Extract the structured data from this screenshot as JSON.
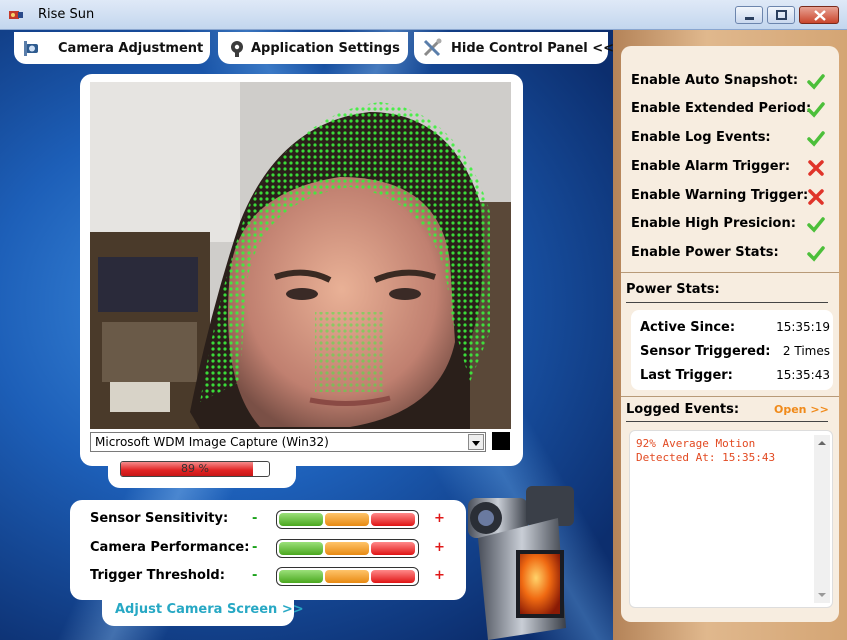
{
  "window": {
    "title": "Rise Sun",
    "icon": "camera-app-icon",
    "buttons": [
      "minimize",
      "maximize",
      "close"
    ]
  },
  "tabs": [
    {
      "label": "Camera Adjustment",
      "icon": "camera-adjust-icon"
    },
    {
      "label": "Application Settings",
      "icon": "settings-icon"
    },
    {
      "label": "Hide Control Panel <<",
      "icon": "tools-icon"
    }
  ],
  "capture": {
    "device": "Microsoft WDM Image Capture (Win32)",
    "motion_level": 89,
    "motion_text": "89 %"
  },
  "controls": [
    {
      "label": "Sensor Sensitivity:",
      "minus": "-",
      "plus": "+"
    },
    {
      "label": "Camera Performance:",
      "minus": "-",
      "plus": "+"
    },
    {
      "label": "Trigger Threshold:",
      "minus": "-",
      "plus": "+"
    }
  ],
  "adjust_link": "Adjust Camera Screen >>",
  "options": [
    {
      "label": "Enable Auto Snapshot:",
      "state": "enabled",
      "icon": "check-icon"
    },
    {
      "label": "Enable Extended Period:",
      "state": "enabled",
      "icon": "check-icon"
    },
    {
      "label": "Enable Log Events:",
      "state": "enabled",
      "icon": "check-icon"
    },
    {
      "label": "Enable Alarm Trigger:",
      "state": "disabled",
      "icon": "cross-icon"
    },
    {
      "label": "Enable Warning Trigger:",
      "state": "disabled",
      "icon": "cross-icon"
    },
    {
      "label": "Enable High Presicion:",
      "state": "enabled",
      "icon": "check-icon"
    },
    {
      "label": "Enable Power Stats:",
      "state": "enabled",
      "icon": "check-icon"
    }
  ],
  "power_stats": {
    "title": "Power Stats:",
    "active_since_label": "Active Since:",
    "active_since": "15:35:19",
    "sensor_triggered_label": "Sensor Triggered:",
    "sensor_triggered": "2 Times",
    "last_trigger_label": "Last Trigger:",
    "last_trigger": "15:35:43"
  },
  "logged_events": {
    "title": "Logged Events:",
    "open_label": "Open >>",
    "text": "92% Average Motion\nDetected At: 15:35:43"
  },
  "colors": {
    "check": "#4cbf3a",
    "cross": "#e0342a",
    "accent_link": "#27a8c4",
    "event_text": "#e24a22",
    "open_link": "#f08a1a"
  }
}
